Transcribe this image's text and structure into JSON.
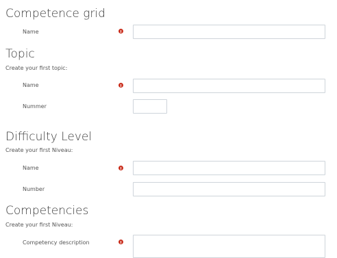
{
  "sections": {
    "competence_grid": {
      "title": "Competence grid",
      "fields": {
        "name": {
          "label": "Name",
          "value": "",
          "required": true
        }
      }
    },
    "topic": {
      "title": "Topic",
      "subtitle": "Create your first topic:",
      "fields": {
        "name": {
          "label": "Name",
          "value": "",
          "required": true
        },
        "nummer": {
          "label": "Nummer",
          "value": "",
          "required": false
        }
      }
    },
    "difficulty_level": {
      "title": "Difficulty Level",
      "subtitle": "Create your first Niveau:",
      "fields": {
        "name": {
          "label": "Name",
          "value": "",
          "required": true
        },
        "number": {
          "label": "Number",
          "value": "",
          "required": false
        }
      }
    },
    "competencies": {
      "title": "Competencies",
      "subtitle": "Create your first Niveau:",
      "fields": {
        "description": {
          "label": "Competency description",
          "value": "",
          "required": true
        }
      }
    }
  },
  "icons": {
    "required": "exclamation-circle-icon"
  },
  "colors": {
    "required_icon": "#ca3120",
    "input_border": "#ced4da",
    "text": "#3a3a3a"
  }
}
